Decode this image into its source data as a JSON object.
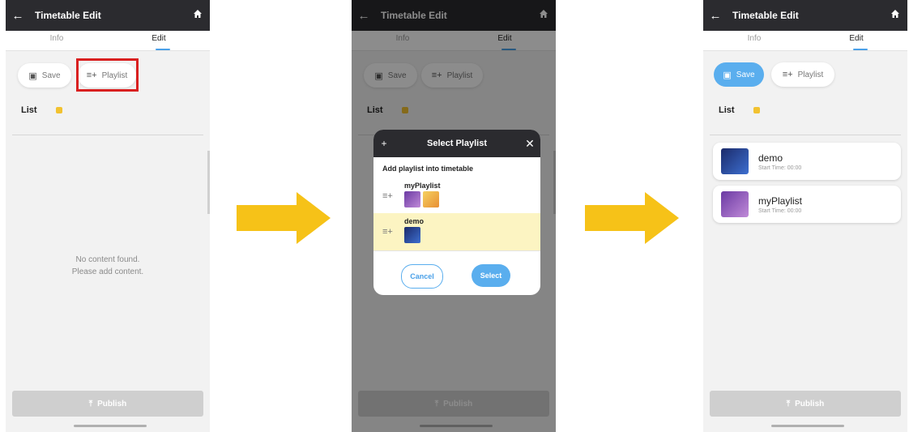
{
  "colors": {
    "appbar": "#2b2b2f",
    "accent": "#5aaeee",
    "arrow": "#f6c218",
    "highlight": "#d92020",
    "selected_row": "#fcf4c2"
  },
  "app": {
    "title": "Timetable Edit",
    "tabs": [
      "Info",
      "Edit"
    ],
    "active_tab": "Edit"
  },
  "toolbar": {
    "save_label": "Save",
    "playlist_label": "Playlist"
  },
  "list": {
    "label": "List"
  },
  "empty_state": {
    "line1": "No content found.",
    "line2": "Please add content."
  },
  "publish_label": "Publish",
  "dialog": {
    "title": "Select Playlist",
    "subtitle": "Add playlist into timetable",
    "items": [
      {
        "name": "myPlaylist",
        "thumbnails": 2,
        "selected": false
      },
      {
        "name": "demo",
        "thumbnails": 1,
        "selected": true
      }
    ],
    "cancel_label": "Cancel",
    "select_label": "Select"
  },
  "result_list": [
    {
      "name": "demo",
      "start_time": "Start Time: 00:00"
    },
    {
      "name": "myPlaylist",
      "start_time": "Start Time: 00:00"
    }
  ],
  "icons": {
    "back": "arrow-left-icon",
    "home": "home-icon",
    "save": "floppy-disk-icon",
    "playlist_add": "playlist-add-icon",
    "close": "close-icon",
    "plus": "plus-icon",
    "publish": "publish-upload-icon"
  }
}
